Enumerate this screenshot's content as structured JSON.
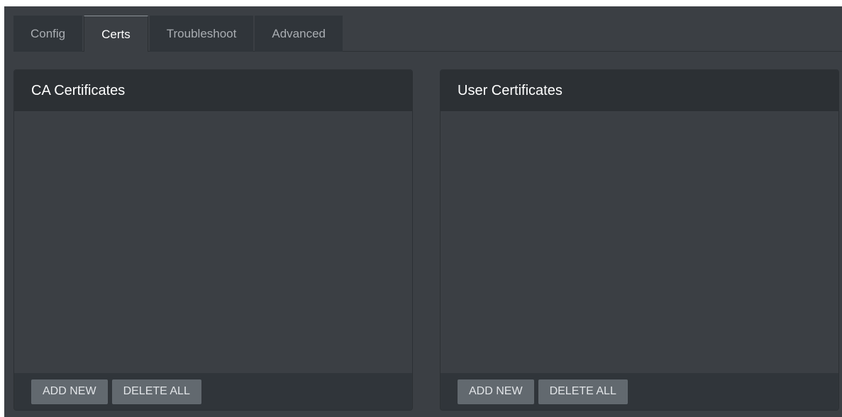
{
  "tabs": [
    {
      "label": "Config",
      "active": false
    },
    {
      "label": "Certs",
      "active": true
    },
    {
      "label": "Troubleshoot",
      "active": false
    },
    {
      "label": "Advanced",
      "active": false
    }
  ],
  "panels": {
    "ca": {
      "title": "CA Certificates",
      "add_label": "ADD NEW",
      "delete_label": "DELETE ALL"
    },
    "user": {
      "title": "User Certificates",
      "add_label": "ADD NEW",
      "delete_label": "DELETE ALL"
    }
  },
  "colors": {
    "background": "#3b3f44",
    "header": "#2c3034",
    "button": "#62696f"
  }
}
